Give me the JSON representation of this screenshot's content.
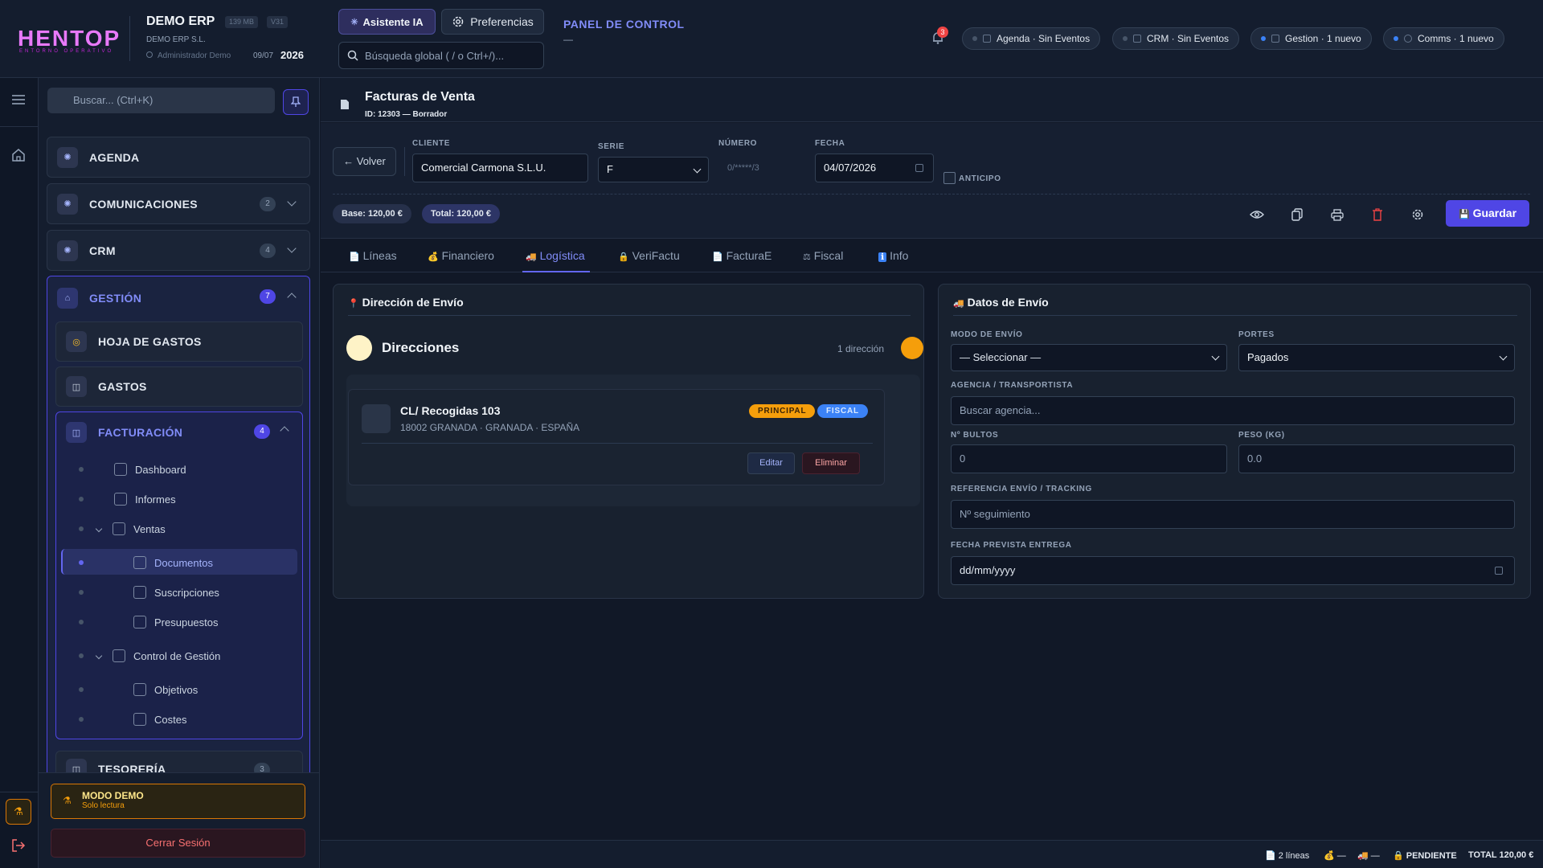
{
  "topbar": {
    "logo": "HENTOP",
    "logo_sub": "ENTORNO OPERATIVO",
    "app_title": "DEMO ERP",
    "mem_badge": "139 MB",
    "version_badge": "V31",
    "company": "DEMO ERP S.L.",
    "user": "Administrador Demo",
    "date": "09/07",
    "year": "2026",
    "ai_button": "Asistente IA",
    "prefs_button": "Preferencias",
    "global_search_placeholder": "Búsqueda global ( / o Ctrl+/)...",
    "panel_title": "PANEL DE CONTROL",
    "panel_sub": "—",
    "notif_count": "3",
    "chips": [
      {
        "label": "Agenda · Sin Eventos",
        "icon": "calendar-icon",
        "dot": "gray"
      },
      {
        "label": "CRM · Sin Eventos",
        "icon": "crm-icon",
        "dot": "gray"
      },
      {
        "label": "Gestion · 1 nuevo",
        "icon": "doc-icon",
        "dot": "blue"
      },
      {
        "label": "Comms · 1 nuevo",
        "icon": "chat-icon",
        "dot": "blue"
      }
    ]
  },
  "sidebar": {
    "search_placeholder": "Buscar... (Ctrl+K)",
    "items": [
      {
        "label": "AGENDA",
        "badge": ""
      },
      {
        "label": "COMUNICACIONES",
        "badge": "2"
      },
      {
        "label": "CRM",
        "badge": "4"
      }
    ],
    "gestion": {
      "label": "GESTIÓN",
      "badge": "7",
      "sub": [
        {
          "label": "HOJA DE GASTOS"
        },
        {
          "label": "GASTOS"
        }
      ],
      "facturacion": {
        "label": "FACTURACIÓN",
        "badge": "4",
        "tree": [
          {
            "label": "Dashboard"
          },
          {
            "label": "Informes"
          },
          {
            "label": "Ventas"
          },
          {
            "label": "Documentos"
          },
          {
            "label": "Suscripciones"
          },
          {
            "label": "Presupuestos"
          },
          {
            "label": "Control de Gestión"
          },
          {
            "label": "Objetivos"
          },
          {
            "label": "Costes"
          }
        ]
      },
      "tesoreria": {
        "label": "TESORERÍA",
        "badge": "3"
      }
    },
    "demo_title": "MODO DEMO",
    "demo_sub": "Solo lectura",
    "logout": "Cerrar Sesión"
  },
  "doc": {
    "title": "Facturas de Venta",
    "id_line": "ID: 12303 — Borrador",
    "back": "← Volver",
    "labels": {
      "cliente": "CLIENTE",
      "serie": "SERIE",
      "numero": "NÚMERO",
      "fecha": "FECHA",
      "anticipo": "ANTICIPO"
    },
    "cliente": "Comercial Carmona S.L.U.",
    "serie": "F",
    "numero": "0/*****/3",
    "fecha": "04/07/2026",
    "base": "Base: 120,00 €",
    "total": "Total: 120,00 €",
    "save": "Guardar"
  },
  "tabs": [
    {
      "label": "Líneas",
      "icon": "📄"
    },
    {
      "label": "Financiero",
      "icon": "💰"
    },
    {
      "label": "Logística",
      "icon": "🚚"
    },
    {
      "label": "VeriFactu",
      "icon": "🔒"
    },
    {
      "label": "FacturaE",
      "icon": "📄"
    },
    {
      "label": "Fiscal",
      "icon": "⚖"
    },
    {
      "label": "Info",
      "icon": "ℹ"
    }
  ],
  "direccion": {
    "title": "Dirección de Envío",
    "section": "Direcciones",
    "count": "1 dirección",
    "street": "CL/ Recogidas 103",
    "city": "18002 GRANADA · GRANADA · ESPAÑA",
    "tag_principal": "PRINCIPAL",
    "tag_fiscal": "FISCAL",
    "edit": "Editar",
    "delete": "Eliminar"
  },
  "envio": {
    "title": "Datos de Envío",
    "modo_label": "MODO DE ENVÍO",
    "modo_value": "— Seleccionar —",
    "portes_label": "PORTES",
    "portes_value": "Pagados",
    "agencia_label": "AGENCIA / TRANSPORTISTA",
    "agencia_placeholder": "Buscar agencia...",
    "bultos_label": "Nº BULTOS",
    "bultos_value": "0",
    "peso_label": "PESO (KG)",
    "peso_value": "0.0",
    "ref_label": "REFERENCIA ENVÍO / TRACKING",
    "ref_placeholder": "Nº seguimiento",
    "fecha_label": "FECHA PREVISTA ENTREGA",
    "fecha_placeholder": "dd/mm/yyyy"
  },
  "status": {
    "lineas": "📄 2 líneas",
    "fin": "💰 —",
    "log": "🚚 —",
    "estado": "🔒 PENDIENTE",
    "total": "TOTAL 120,00 €"
  },
  "colors": {
    "accent": "#4f46e5",
    "accent_text": "#818cf8",
    "warning": "#f59e0b",
    "danger": "#ef4444"
  }
}
